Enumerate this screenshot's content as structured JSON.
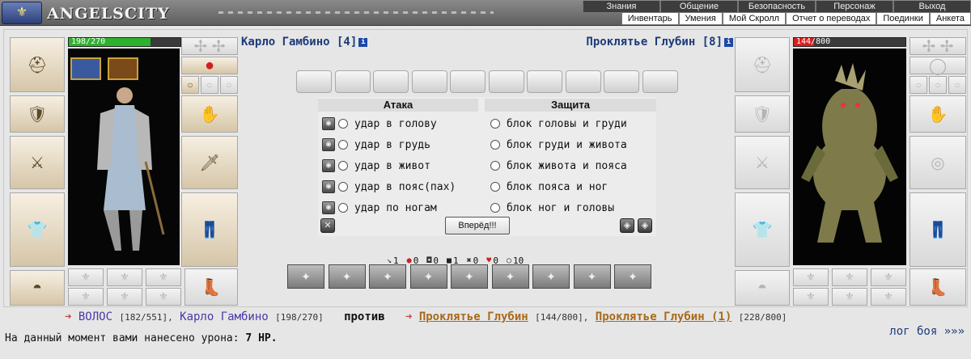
{
  "header": {
    "logo_text": "ANGELSCITY",
    "menu_top": [
      "Знания",
      "Общение",
      "Безопасность",
      "Персонаж",
      "Выход"
    ],
    "menu_bottom": [
      "Инвентарь",
      "Умения",
      "Мой Скролл",
      "Отчет о переводах",
      "Поединки",
      "Анкета"
    ]
  },
  "player": {
    "name": "Карло Гамбино [4]",
    "hp_text": "198/270",
    "hp_fraction": 0.733,
    "hp_color": "#2fb12f"
  },
  "opponent": {
    "name": "Проклятье Глубин [8]",
    "hp_text": "144/800",
    "hp_fraction": 0.18,
    "hp_color": "#d42020"
  },
  "info_icon": "i",
  "panel": {
    "attack_title": "Атака",
    "defense_title": "Защита",
    "attacks": [
      "удар в голову",
      "удар в грудь",
      "удар в живот",
      "удар в пояс(пах)",
      "удар по ногам"
    ],
    "blocks": [
      "блок головы и груди",
      "блок груди и живота",
      "блок живота и пояса",
      "блок пояса и ног",
      "блок ног и головы"
    ],
    "go_button": "Вперёд!!!"
  },
  "stats": [
    {
      "icon": "sword-icon",
      "glyph": "↘",
      "value": "1",
      "color": "#333"
    },
    {
      "icon": "blood-drop-icon",
      "glyph": "●",
      "value": "0",
      "color": "#c22"
    },
    {
      "icon": "shield-icon",
      "glyph": "◘",
      "value": "0",
      "color": "#333"
    },
    {
      "icon": "armor-icon",
      "glyph": "■",
      "value": "1",
      "color": "#222"
    },
    {
      "icon": "cross-icon",
      "glyph": "✖",
      "value": "0",
      "color": "#333"
    },
    {
      "icon": "heart-icon",
      "glyph": "♥",
      "value": "0",
      "color": "#c22"
    },
    {
      "icon": "ring-icon",
      "glyph": "○",
      "value": "10",
      "color": "#333"
    }
  ],
  "bottom": {
    "player_link": "ВОЛОС",
    "player_hp": "[182/551],",
    "player2_link": "Карло Гамбино",
    "player2_hp": "[198/270]",
    "versus": "против",
    "enemy_link": "Проклятье Глубин",
    "enemy_hp": "[144/800],",
    "enemy2_link": "Проклятье Глубин (1)",
    "enemy2_hp": "[228/800]",
    "damage_prefix": "На данный момент вами нанесено урона:",
    "damage_value": "7 HP.",
    "log_link": "лог боя »»»"
  }
}
